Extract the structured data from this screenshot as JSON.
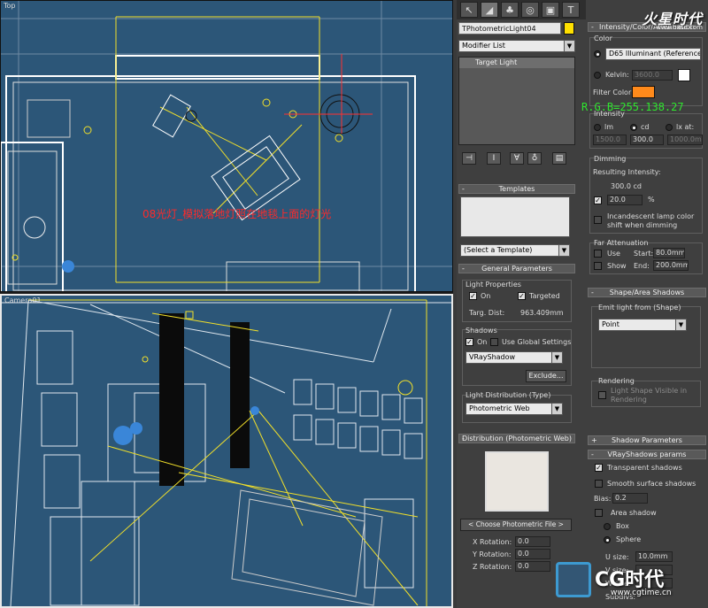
{
  "viewports": {
    "top_label": "Top",
    "camera_label": "Camera01",
    "annotation": "08光灯_模拟落地灯照在地毯上面的灯光"
  },
  "command_panel": {
    "tab_icons": [
      "create-icon",
      "modify-icon",
      "hierarchy-icon",
      "motion-icon",
      "display-icon",
      "utilities-icon"
    ],
    "object_name": "TPhotometricLight04",
    "object_color": "#ffe000",
    "modifier_list": "Modifier List",
    "stack_item": "Target Light",
    "stack_icons": [
      "pin-stack-icon",
      "show-end-result-icon",
      "make-unique-icon",
      "remove-modifier-icon",
      "configure-sets-icon"
    ]
  },
  "templates": {
    "header": "Templates",
    "select": "(Select a Template)"
  },
  "general_parameters": {
    "header": "General Parameters",
    "light_properties": "Light Properties",
    "on_label": "On",
    "targeted_label": "Targeted",
    "targ_dist_label": "Targ. Dist:",
    "targ_dist_value": "963.409mm",
    "shadows_label": "Shadows",
    "shadows_on_label": "On",
    "use_global_label": "Use Global Settings",
    "shadow_type": "VRayShadow",
    "exclude_button": "Exclude...",
    "light_dist_label": "Light Distribution (Type)",
    "light_dist_value": "Photometric Web"
  },
  "distribution": {
    "header": "Distribution (Photometric Web)",
    "choose_button": "< Choose Photometric File >",
    "x_rotation_label": "X Rotation:",
    "x_rotation_value": "0.0",
    "y_rotation_label": "Y Rotation:",
    "y_rotation_value": "0.0",
    "z_rotation_label": "Z Rotation:",
    "z_rotation_value": "0.0"
  },
  "intensity_color": {
    "header": "Intensity/Color/Attenuation",
    "color_label": "Color",
    "illuminant": "D65 Illuminant (Reference",
    "kelvin_label": "Kelvin:",
    "kelvin_value": "3600.0",
    "filter_color_label": "Filter Color:",
    "filter_color": "#ff8a1b",
    "intensity_label": "Intensity",
    "lm_label": "lm",
    "cd_label": "cd",
    "lx_at_label": "lx at:",
    "lm_value": "1500.0",
    "cd_value": "300.0",
    "lx_value": "1000.0mm",
    "dimming_label": "Dimming",
    "resulting_label": "Resulting Intensity:",
    "resulting_value": "300.0 cd",
    "dim_percent": "20.0",
    "percent_sign": "%",
    "incandescent_label": "Incandescent lamp color shift when dimming",
    "far_atten_label": "Far Attenuation",
    "use_label": "Use",
    "show_label": "Show",
    "start_label": "Start:",
    "start_value": "80.0mm",
    "end_label": "End:",
    "end_value": "200.0mm"
  },
  "shape_area": {
    "header": "Shape/Area Shadows",
    "emit_label": "Emit light from (Shape)",
    "shape_value": "Point",
    "rendering_label": "Rendering",
    "light_shape_visible": "Light Shape Visible in Rendering"
  },
  "shadow_parameters": {
    "header": "Shadow Parameters"
  },
  "vray_shadows": {
    "header": "VRayShadows params",
    "transparent_label": "Transparent shadows",
    "smooth_label": "Smooth surface shadows",
    "bias_label": "Bias:",
    "bias_value": "0.2",
    "area_shadow_label": "Area shadow",
    "box_label": "Box",
    "sphere_label": "Sphere",
    "u_size_label": "U size:",
    "u_size_value": "10.0mm",
    "v_size_label": "V size:",
    "w_size_label": "W size:",
    "subdivs_label": "Subdivs:"
  },
  "overlay": {
    "rgb_note": "R.G.B=255.138.27",
    "site_logo": "火星时代",
    "site_url": "www.hxsd.com",
    "cg_logo": "CG时代",
    "cg_url": "www.cgtime.cn"
  }
}
